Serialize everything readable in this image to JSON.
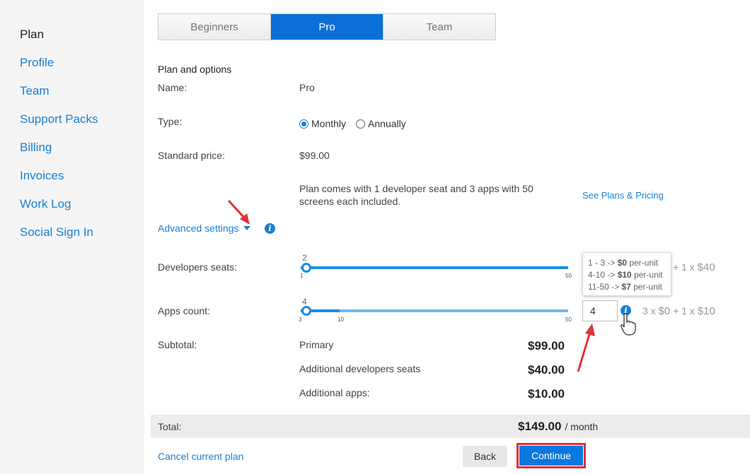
{
  "sidebar": {
    "items": [
      {
        "label": "Plan",
        "active": true
      },
      {
        "label": "Profile"
      },
      {
        "label": "Team"
      },
      {
        "label": "Support Packs"
      },
      {
        "label": "Billing"
      },
      {
        "label": "Invoices"
      },
      {
        "label": "Work Log"
      },
      {
        "label": "Social Sign In"
      }
    ]
  },
  "tabs": [
    {
      "label": "Beginners"
    },
    {
      "label": "Pro",
      "active": true
    },
    {
      "label": "Team"
    }
  ],
  "plan": {
    "section_title": "Plan and options",
    "name_label": "Name:",
    "name_value": "Pro",
    "type_label": "Type:",
    "type_options": [
      "Monthly",
      "Annually"
    ],
    "type_selected": "Monthly",
    "price_label": "Standard price:",
    "price_value": "$99.00",
    "description": "Plan comes with 1 developer seat and 3 apps with 50 screens each included.",
    "pricing_link": "See Plans & Pricing",
    "advanced_settings": "Advanced settings"
  },
  "developers": {
    "label": "Developers seats:",
    "value": "2",
    "min": "1",
    "max": "50",
    "formula_suffix": "+ 1 x",
    "formula_price": "$40"
  },
  "tooltip": {
    "lines": [
      {
        "range": "1 - 3 ->",
        "price": "$0",
        "unit": "per-unit"
      },
      {
        "range": "4-10 ->",
        "price": "$10",
        "unit": "per-unit"
      },
      {
        "range": "11-50 ->",
        "price": "$7",
        "unit": "per-unit"
      }
    ]
  },
  "apps": {
    "label": "Apps count:",
    "value": "4",
    "min": "3",
    "mid": "10",
    "max": "50",
    "input_value": "4",
    "formula_a": "3 x",
    "formula_a_price": "$0",
    "formula_b": "+ 1 x",
    "formula_b_price": "$10"
  },
  "subtotal": {
    "label": "Subtotal:",
    "rows": [
      {
        "label": "Primary",
        "amount": "$99.00"
      },
      {
        "label": "Additional developers seats",
        "amount": "$40.00"
      },
      {
        "label": "Additional apps:",
        "amount": "$10.00"
      }
    ]
  },
  "total": {
    "label": "Total:",
    "amount": "$149.00",
    "period": "/ month"
  },
  "actions": {
    "cancel_plan": "Cancel current plan",
    "back": "Back",
    "continue": "Continue"
  },
  "colors": {
    "accent": "#0a6fd6",
    "annotation": "#e0333a"
  }
}
